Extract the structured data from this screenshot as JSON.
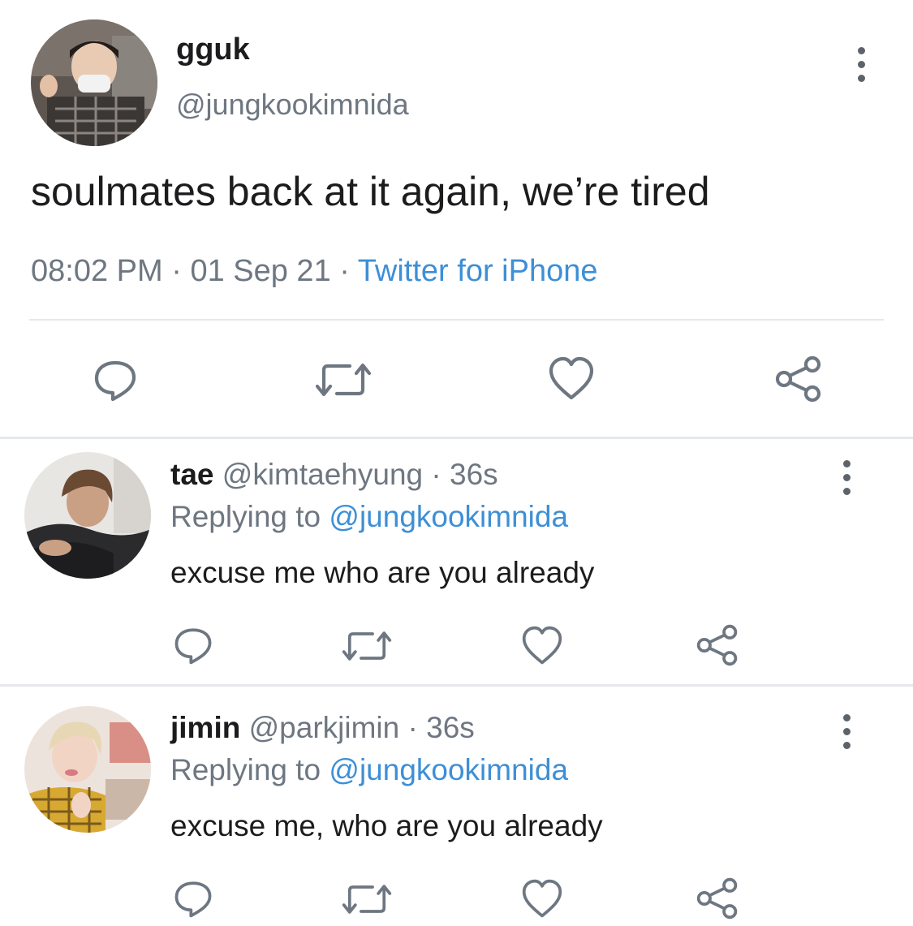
{
  "main_tweet": {
    "display_name": "gguk",
    "handle": "@jungkookimnida",
    "text": "soulmates back at it again, we’re tired",
    "time": "08:02 PM",
    "date": "01 Sep 21",
    "sep": "·",
    "source": "Twitter for iPhone",
    "avatar_icon": "profile-photo"
  },
  "actions": {
    "reply_icon": "reply-icon",
    "retweet_icon": "retweet-icon",
    "like_icon": "heart-icon",
    "share_icon": "share-icon"
  },
  "replies": [
    {
      "display_name": "tae",
      "handle": "@kimtaehyung",
      "sep": "·",
      "age": "36s",
      "replying_label": "Replying to",
      "replying_to": "@jungkookimnida",
      "text": "excuse me who are you already"
    },
    {
      "display_name": "jimin",
      "handle": "@parkjimin",
      "sep": "·",
      "age": "36s",
      "replying_label": "Replying to",
      "replying_to": "@jungkookimnida",
      "text": "excuse me, who are you already"
    }
  ],
  "colors": {
    "link_blue": "#3d8fd6",
    "meta_grey": "#6e7781",
    "divider": "#e6e8eb"
  }
}
